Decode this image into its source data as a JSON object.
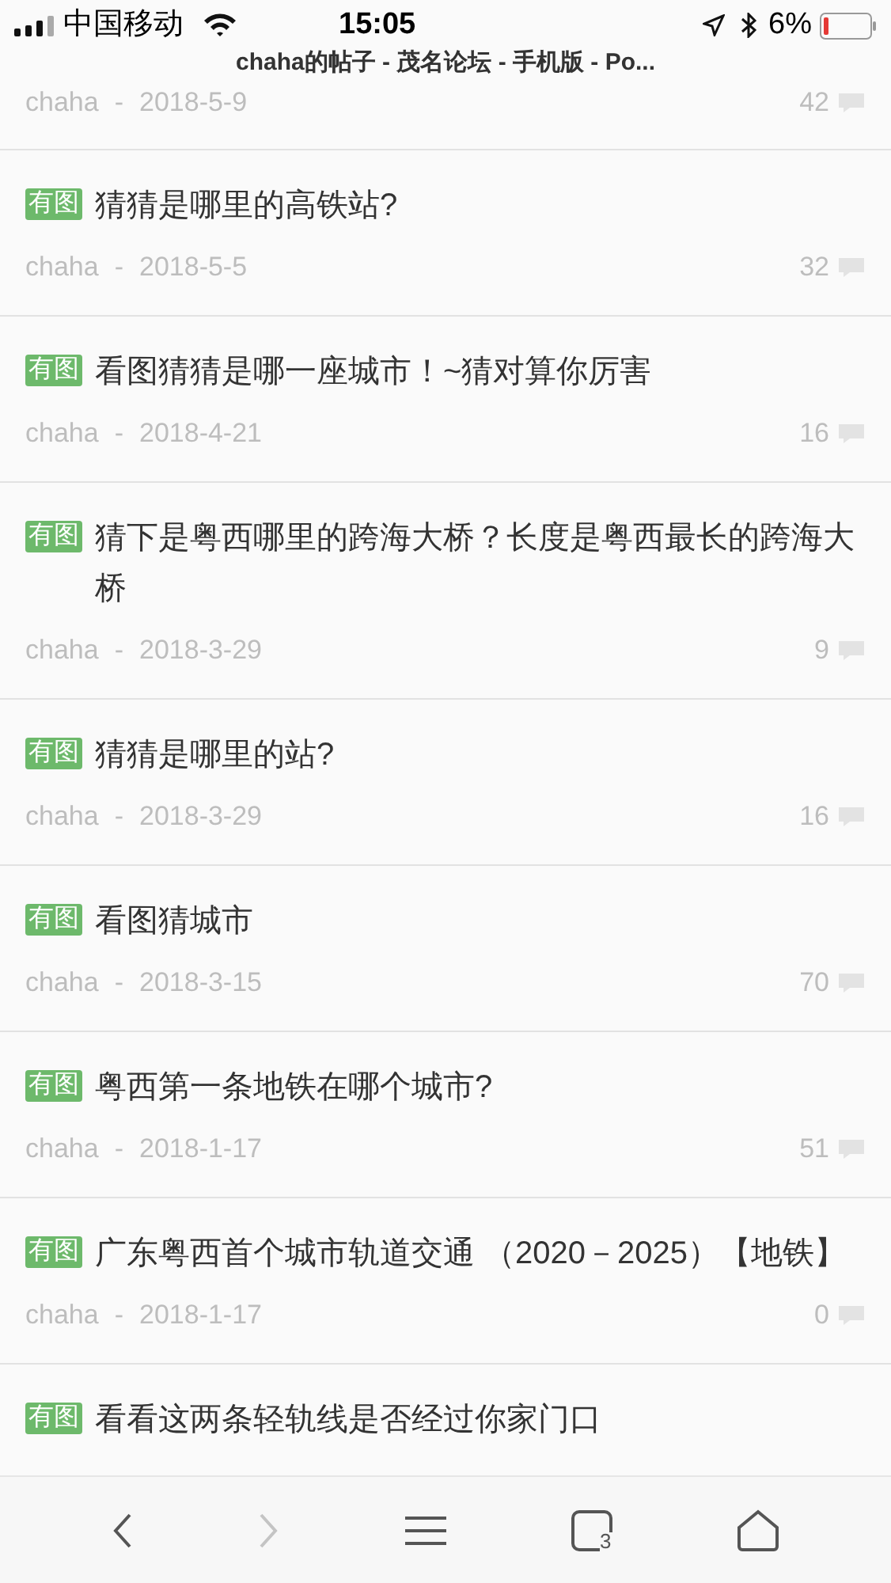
{
  "status_bar": {
    "carrier": "中国移动",
    "time": "15:05",
    "battery": "6%",
    "page_title": "chaha的帖子 - 茂名论坛 - 手机版 - Po..."
  },
  "posts": [
    {
      "author": "chaha",
      "separator": "-",
      "date": "2018-5-9",
      "replies": "42"
    },
    {
      "badge": "有图",
      "title": "猜猜是哪里的高铁站?",
      "author": "chaha",
      "separator": "-",
      "date": "2018-5-5",
      "replies": "32"
    },
    {
      "badge": "有图",
      "title": "看图猜猜是哪一座城市！~猜对算你厉害",
      "author": "chaha",
      "separator": "-",
      "date": "2018-4-21",
      "replies": "16"
    },
    {
      "badge": "有图",
      "title": "猜下是粤西哪里的跨海大桥？长度是粤西最长的跨海大桥",
      "author": "chaha",
      "separator": "-",
      "date": "2018-3-29",
      "replies": "9"
    },
    {
      "badge": "有图",
      "title": "猜猜是哪里的站?",
      "author": "chaha",
      "separator": "-",
      "date": "2018-3-29",
      "replies": "16"
    },
    {
      "badge": "有图",
      "title": "看图猜城市",
      "author": "chaha",
      "separator": "-",
      "date": "2018-3-15",
      "replies": "70"
    },
    {
      "badge": "有图",
      "title": "粤西第一条地铁在哪个城市?",
      "author": "chaha",
      "separator": "-",
      "date": "2018-1-17",
      "replies": "51"
    },
    {
      "badge": "有图",
      "title": "广东粤西首个城市轨道交通 （2020－2025）【地铁】",
      "author": "chaha",
      "separator": "-",
      "date": "2018-1-17",
      "replies": "0"
    },
    {
      "badge": "有图",
      "title": "看看这两条轻轨线是否经过你家门口"
    }
  ],
  "toolbar": {
    "back": {
      "disabled": false
    },
    "forward": {
      "disabled": true
    },
    "tab_count": "3"
  }
}
